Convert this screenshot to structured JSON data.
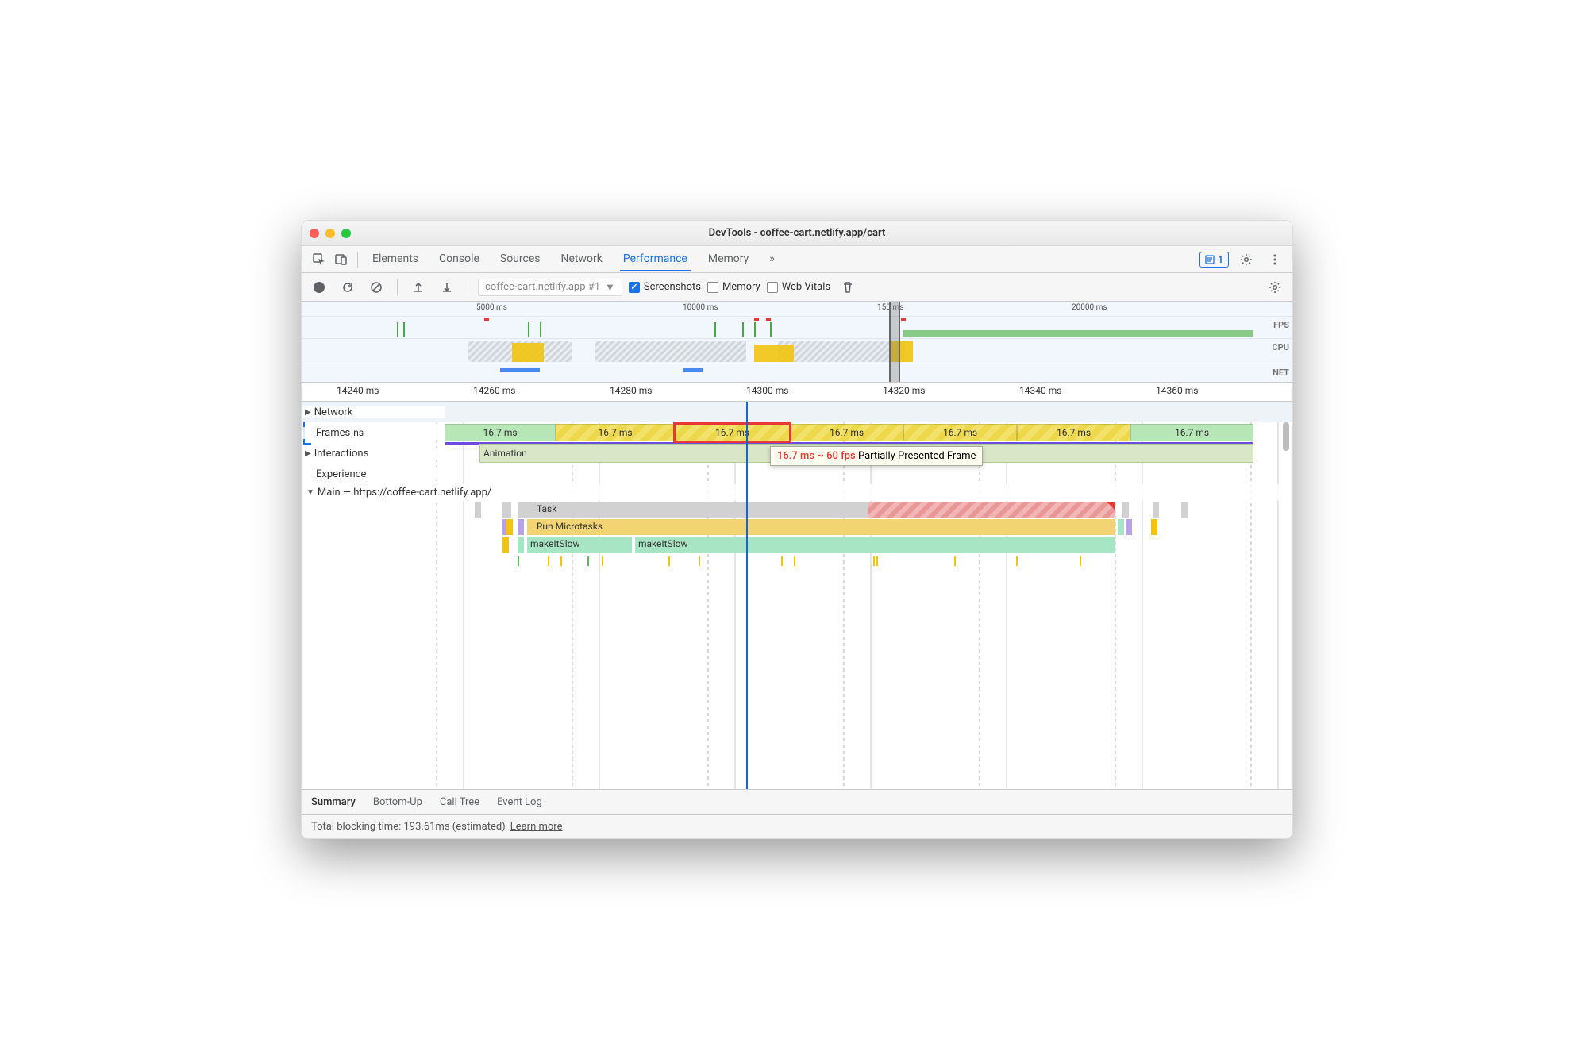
{
  "window": {
    "title": "DevTools - coffee-cart.netlify.app/cart"
  },
  "tabs": {
    "items": [
      "Elements",
      "Console",
      "Sources",
      "Network",
      "Performance",
      "Memory"
    ],
    "active": "Performance",
    "moreGlyph": "»",
    "badgeCount": "1"
  },
  "toolbar": {
    "recording": "coffee-cart.netlify.app #1",
    "screenshots": {
      "label": "Screenshots",
      "checked": true
    },
    "memory": {
      "label": "Memory",
      "checked": false
    },
    "webVitals": {
      "label": "Web Vitals",
      "checked": false
    }
  },
  "overview": {
    "ticks": [
      "5000 ms",
      "10000 ms",
      "150    ms",
      "20000 ms"
    ],
    "labels": {
      "fps": "FPS",
      "cpu": "CPU",
      "net": "NET"
    }
  },
  "ruler": [
    "14240 ms",
    "14260 ms",
    "14280 ms",
    "14300 ms",
    "14320 ms",
    "14340 ms",
    "14360 ms"
  ],
  "tracks": {
    "network": "Network",
    "frames": {
      "label": "Frames",
      "extraLabel": "ns",
      "items": [
        {
          "text": "16.7 ms",
          "style": "green"
        },
        {
          "text": "16.7 ms",
          "style": "yellow"
        },
        {
          "text": "16.7 ms",
          "style": "yellow",
          "selected": true
        },
        {
          "text": "16.7 ms",
          "style": "yellow"
        },
        {
          "text": "16.7 ms",
          "style": "yellow"
        },
        {
          "text": "16.7 ms",
          "style": "yellow"
        },
        {
          "text": "16.7 ms",
          "style": "green"
        }
      ]
    },
    "interactions": {
      "label": "Interactions",
      "animation": "Animation"
    },
    "experience": "Experience",
    "main": "Main — https://coffee-cart.netlify.app/"
  },
  "tooltip": {
    "duration": "16.7 ms ~ 60 fps",
    "status": "Partially Presented Frame"
  },
  "flame": {
    "task": "Task",
    "runMicrotasks": "Run Microtasks",
    "make1": "makeItSlow",
    "make2": "makeItSlow"
  },
  "bottomTabs": [
    "Summary",
    "Bottom-Up",
    "Call Tree",
    "Event Log"
  ],
  "statusbar": {
    "text": "Total blocking time: 193.61ms (estimated)",
    "link": "Learn more"
  }
}
